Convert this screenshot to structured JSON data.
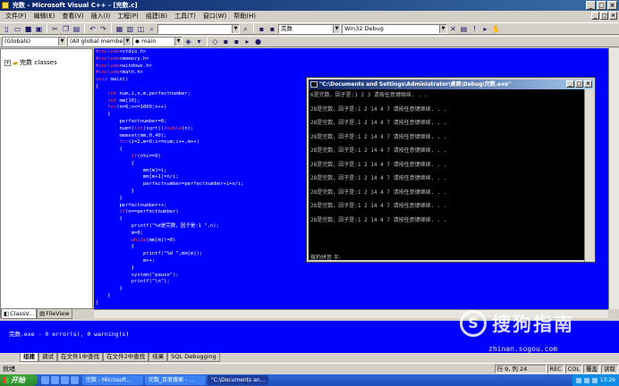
{
  "window": {
    "title": "完数 - Microsoft Visual C++ - [完数.c]",
    "btn_min": "_",
    "btn_max": "□",
    "btn_close": "×"
  },
  "menu": [
    "文件(F)",
    "编辑(E)",
    "查看(V)",
    "插入(I)",
    "工程(P)",
    "组建(B)",
    "工具(T)",
    "窗口(W)",
    "帮助(H)"
  ],
  "toolbar": {
    "find_combo": "",
    "config_combo": "完数",
    "platform_combo": "Win32 Debug"
  },
  "wizardbar": {
    "scope": "(Globals)",
    "members": "(All global members",
    "function": "main"
  },
  "workspace": {
    "tree_root": "完数 classes",
    "tabs": [
      "ClassV...",
      "FileView"
    ]
  },
  "code_lines": [
    "#include<stdio.h>",
    "#include<memory.h>",
    "#include<windows.h>",
    "#include<math.h>",
    "void main()",
    "{",
    "    int num,i,n,m,perfectnumber;",
    "    int mm[10];",
    "    for(n=6;n<=1000;n++)",
    "    {",
    "        perfectnumber=0;",
    "        num=(int)sqrt((double)n);",
    "        memset(mm,0,40);",
    "        for(i=2,m=0;i<=num;i++,m++)",
    "        {",
    "            if(n%i==0)",
    "            {",
    "                mm[m]=i;",
    "                mm[m+1]=n/i;",
    "                perfectnumber=perfectnumber+i+n/i;",
    "            }",
    "        }",
    "        perfectnumber++;",
    "        if(n==perfectnumber)",
    "        {",
    "            printf(\"%d是完数，因子是:1 \",n);",
    "            m=0;",
    "            while(mm[m]!=0)",
    "            {",
    "                printf(\"%d \",mm[m]);",
    "                m++;",
    "            }",
    "            system(\"pause\");",
    "            printf(\"\\n\");",
    "        }",
    "    }",
    "}"
  ],
  "console": {
    "title": "\"C:\\Documents and Settings\\Administrator\\桌面\\Debug\\完数.exe\"",
    "lines": [
      "6是完数，因子是:1 2 3 请按任意键继续. . .",
      "28是完数，因子是:1 2 14 4 7 请按任意键继续. . .",
      "28是完数，因子是:1 2 14 4 7 请按任意键继续. . .",
      "28是完数，因子是:1 2 14 4 7 请按任意键继续. . .",
      "28是完数，因子是:1 2 14 4 7 请按任意键继续. . .",
      "28是完数，因子是:1 2 14 4 7 请按任意键继续. . .",
      "28是完数，因子是:1 2 14 4 7 请按任意键继续. . .",
      "28是完数，因子是:1 2 14 4 7 请按任意键继续. . .",
      "28是完数，因子是:1 2 14 4 7 请按任意键继续. . .",
      "28是完数，因子是:1 2 14 4 7 请按任意键继续. . ."
    ],
    "status": "搜狗拼音 半:"
  },
  "output": {
    "text": "完数.exe - 0 error(s), 0 warning(s)",
    "tabs": [
      "组建",
      "调试",
      "在文件1中查找",
      "在文件2中查找",
      "结果",
      "SQL Debugging"
    ]
  },
  "statusbar": {
    "text": "就绪",
    "position": "行 9, 列 24",
    "rec": "REC",
    "col": "COL",
    "ovr": "覆盖",
    "read": "读取"
  },
  "taskbar": {
    "start": "开始",
    "tasks": [
      "完数 - Microsoft...",
      "完数_百度搜索 - ...",
      "\"C:\\Documents an..."
    ],
    "clock": "13:26"
  },
  "watermark": {
    "logo": "S",
    "name": "搜狗指南",
    "url": "zhinan.sogou.com"
  }
}
